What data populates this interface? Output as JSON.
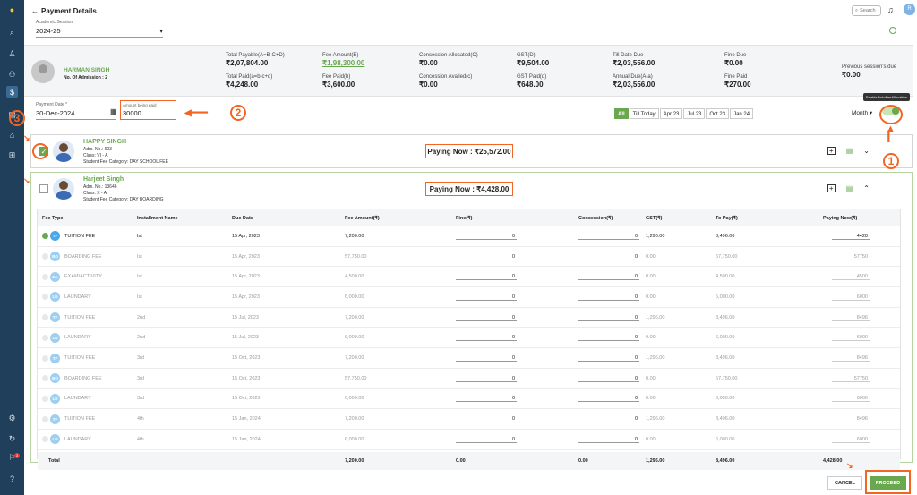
{
  "header": {
    "back_label": "Payment Details",
    "session_label": "Academic Session",
    "session_value": "2024-25",
    "search_placeholder": "Search",
    "user_initial": "R"
  },
  "student": {
    "name": "HARMAN SINGH",
    "admission": "No. Of Admission : 2"
  },
  "summary": [
    {
      "label": "Total Payable(A=B-C+D)",
      "value": "₹2,07,804.00"
    },
    {
      "label": "Total Paid(a=b-c+d)",
      "value": "₹4,248.00"
    },
    {
      "label": "Fee Amount(B)",
      "value": "₹1,98,300.00"
    },
    {
      "label": "Fee Paid(b)",
      "value": "₹3,600.00"
    },
    {
      "label": "Concession Allocated(C)",
      "value": "₹0.00"
    },
    {
      "label": "Concession Availed(c)",
      "value": "₹0.00"
    },
    {
      "label": "GST(D)",
      "value": "₹9,504.00"
    },
    {
      "label": "GST Paid(d)",
      "value": "₹648.00"
    },
    {
      "label": "Till Date Due",
      "value": "₹2,03,556.00"
    },
    {
      "label": "Annual Due(A-a)",
      "value": "₹2,03,556.00"
    },
    {
      "label": "Fine Due",
      "value": "₹0.00"
    },
    {
      "label": "Fine Paid",
      "value": "₹270.00"
    },
    {
      "label": "Previous session's due",
      "value": "₹0.00"
    }
  ],
  "payment": {
    "date_label": "Payment Date *",
    "date_value": "30-Dec-2024",
    "amount_label": "Amount being paid",
    "amount_value": "30000"
  },
  "filters": [
    "All",
    "Till Today",
    "Apr 23",
    "Jul 23",
    "Oct 23",
    "Jan 24"
  ],
  "view_mode": "Month",
  "toggle_tooltip": "Enable AutoFeeAllocation",
  "cards": [
    {
      "name": "HAPPY SINGH",
      "adm": "Adm. No.: 603",
      "class": "Class: VI - A",
      "category": "Student Fee Category: DAY SCHOOL FEE",
      "paying_now": "Paying Now : ₹25,572.00",
      "checked": true
    },
    {
      "name": "Harjeet Singh",
      "adm": "Adm. No.: 13646",
      "class": "Class: X - A",
      "category": "Student Fee Category: DAY BOARDING",
      "paying_now": "Paying Now : ₹4,428.00",
      "checked": false
    }
  ],
  "table": {
    "headers": [
      "Fee Type",
      "Installment Name",
      "Due Date",
      "Fee Amount(₹)",
      "Fine(₹)",
      "Concession(₹)",
      "GST(₹)",
      "To Pay(₹)",
      "Paying Now(₹)"
    ],
    "rows": [
      {
        "badge": "TF",
        "fee_type": "TUITION FEE",
        "installment": "Ist",
        "due": "15 Apr, 2023",
        "amount": "7,200.00",
        "fine": "0",
        "concession": "0",
        "gst": "1,296.00",
        "to_pay": "8,496.00",
        "paying": "4428",
        "paid": true
      },
      {
        "badge": "BO",
        "fee_type": "BOARDING FEE",
        "installment": "Ist",
        "due": "15 Apr, 2023",
        "amount": "57,750.00",
        "fine": "0",
        "concession": "0",
        "gst": "0.00",
        "to_pay": "57,750.00",
        "paying": "57750",
        "paid": false
      },
      {
        "badge": "EA",
        "fee_type": "EXAM/ACTIVITY",
        "installment": "Ist",
        "due": "15 Apr, 2023",
        "amount": "4,500.00",
        "fine": "0",
        "concession": "0",
        "gst": "0.00",
        "to_pay": "4,500.00",
        "paying": "4500",
        "paid": false
      },
      {
        "badge": "LD",
        "fee_type": "LAUNDARY",
        "installment": "Ist",
        "due": "15 Apr, 2023",
        "amount": "6,000.00",
        "fine": "0",
        "concession": "0",
        "gst": "0.00",
        "to_pay": "6,000.00",
        "paying": "6000",
        "paid": false
      },
      {
        "badge": "TF",
        "fee_type": "TUITION FEE",
        "installment": "2nd",
        "due": "15 Jul, 2023",
        "amount": "7,200.00",
        "fine": "0",
        "concession": "0",
        "gst": "1,296.00",
        "to_pay": "8,496.00",
        "paying": "8496",
        "paid": false
      },
      {
        "badge": "LD",
        "fee_type": "LAUNDARY",
        "installment": "2nd",
        "due": "15 Jul, 2023",
        "amount": "6,000.00",
        "fine": "0",
        "concession": "0",
        "gst": "0.00",
        "to_pay": "6,000.00",
        "paying": "6000",
        "paid": false
      },
      {
        "badge": "TF",
        "fee_type": "TUITION FEE",
        "installment": "3rd",
        "due": "15 Oct, 2023",
        "amount": "7,200.00",
        "fine": "0",
        "concession": "0",
        "gst": "1,296.00",
        "to_pay": "8,496.00",
        "paying": "8496",
        "paid": false
      },
      {
        "badge": "BO",
        "fee_type": "BOARDING FEE",
        "installment": "3rd",
        "due": "15 Oct, 2023",
        "amount": "57,750.00",
        "fine": "0",
        "concession": "0",
        "gst": "0.00",
        "to_pay": "57,750.00",
        "paying": "57750",
        "paid": false
      },
      {
        "badge": "LD",
        "fee_type": "LAUNDARY",
        "installment": "3rd",
        "due": "15 Oct, 2023",
        "amount": "6,000.00",
        "fine": "0",
        "concession": "0",
        "gst": "0.00",
        "to_pay": "6,000.00",
        "paying": "6000",
        "paid": false
      },
      {
        "badge": "TF",
        "fee_type": "TUITION FEE",
        "installment": "4th",
        "due": "15 Jan, 2024",
        "amount": "7,200.00",
        "fine": "0",
        "concession": "0",
        "gst": "1,296.00",
        "to_pay": "8,496.00",
        "paying": "8496",
        "paid": false
      },
      {
        "badge": "LD",
        "fee_type": "LAUNDARY",
        "installment": "4th",
        "due": "15 Jan, 2024",
        "amount": "6,000.00",
        "fine": "0",
        "concession": "0",
        "gst": "0.00",
        "to_pay": "6,000.00",
        "paying": "6000",
        "paid": false
      }
    ],
    "total": {
      "label": "Total",
      "amount": "7,200.00",
      "fine": "0.00",
      "concession": "0.00",
      "gst": "1,296.00",
      "to_pay": "8,496.00",
      "paying": "4,428.00"
    }
  },
  "actions": {
    "cancel": "CANCEL",
    "proceed": "PROCEED"
  },
  "annotations": [
    "1",
    "2",
    "3"
  ],
  "colors": {
    "accent": "#6aa84f",
    "annotation": "#f26522",
    "sidebar": "#1f3f5b"
  }
}
